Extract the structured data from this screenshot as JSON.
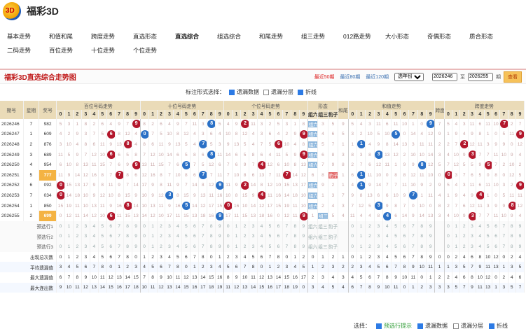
{
  "app": {
    "title": "福彩3D",
    "logo_text": "3D"
  },
  "nav": {
    "row1": [
      "基本走势",
      "和值和尾",
      "跨度走势",
      "直选形态",
      "直选综合",
      "组选综合",
      "和尾走势",
      "组三走势",
      "012路走势",
      "大小形态",
      "奇偶形态",
      "质合形态"
    ],
    "row2": [
      "二码走势",
      "百位走势",
      "十位走势",
      "个位走势"
    ],
    "current": "直选综合"
  },
  "panel": {
    "title": "福彩3D直选综合走势图",
    "recent50": "最近50期",
    "recent80": "最近80期",
    "recent120": "最近120期",
    "select_label": "选年份",
    "from": "2026246",
    "to_label": "至",
    "to": "2026255",
    "period": "期",
    "query": "查看"
  },
  "display": {
    "label": "标注形式选择：",
    "opt1": "遗漏数据",
    "opt2": "遗漏分层",
    "opt3": "折线"
  },
  "headers": {
    "issue": "期号",
    "week": "星期",
    "prize": "奖号",
    "bai": "百位号码走势",
    "shi": "十位号码走势",
    "ge": "个位号码走势",
    "xingtai": "形态",
    "zu6": "组六",
    "zu3": "组三",
    "baozi": "豹子",
    "hewei": "和尾",
    "hezhi": "和值走势",
    "kuadu": "跨度",
    "kuadu_trend": "跨度走势"
  },
  "rows": [
    {
      "issue": "2026246",
      "week": "7",
      "prize": "982"
    },
    {
      "issue": "2026247",
      "week": "1",
      "prize": "609"
    },
    {
      "issue": "2026248",
      "week": "2",
      "prize": "876"
    },
    {
      "issue": "2026249",
      "week": "3",
      "prize": "689"
    },
    {
      "issue": "2026250",
      "week": "4",
      "prize": "954"
    },
    {
      "issue": "2026251",
      "week": "5",
      "prize": "777"
    },
    {
      "issue": "2026252",
      "week": "6",
      "prize": "092"
    },
    {
      "issue": "2026253",
      "week": "7",
      "prize": "034"
    },
    {
      "issue": "2026254",
      "week": "1",
      "prize": "850"
    },
    {
      "issue": "2026255",
      "week": "2",
      "prize": "699"
    }
  ],
  "xingtai_labels": {
    "zu6": "组六",
    "zu3": "组三",
    "baozi": "豹子"
  },
  "preview": [
    "预选行1",
    "预选行2",
    "预选行3"
  ],
  "stats": [
    {
      "label": "出现总次数"
    },
    {
      "label": "平均遗漏值"
    },
    {
      "label": "最大遗漏值"
    },
    {
      "label": "最大连出数"
    }
  ],
  "footer": {
    "label": "选择：",
    "opt1": "预选行提示",
    "opt2": "遗漏数据",
    "opt3": "遗漏分层",
    "opt4": "折线"
  }
}
